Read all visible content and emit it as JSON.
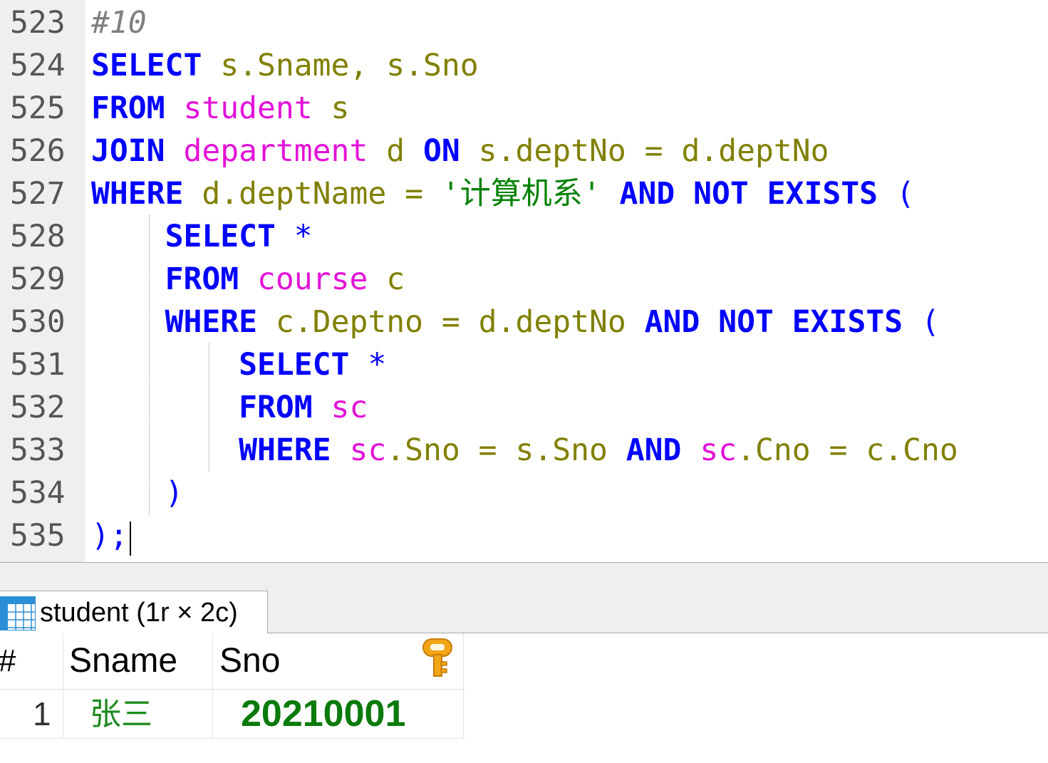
{
  "editor": {
    "lines": [
      {
        "num": "523",
        "tokens": [
          {
            "t": "#10",
            "k": "cm"
          }
        ]
      },
      {
        "num": "524",
        "tokens": [
          {
            "t": "SELECT",
            "k": "kw"
          },
          {
            "t": " s.Sname, s.Sno",
            "k": "id"
          }
        ]
      },
      {
        "num": "525",
        "tokens": [
          {
            "t": "FROM",
            "k": "kw"
          },
          {
            "t": " student",
            "k": "tb"
          },
          {
            "t": " s",
            "k": "id"
          }
        ]
      },
      {
        "num": "526",
        "tokens": [
          {
            "t": "JOIN",
            "k": "kw"
          },
          {
            "t": " department",
            "k": "tb"
          },
          {
            "t": " d ",
            "k": "id"
          },
          {
            "t": "ON",
            "k": "kw"
          },
          {
            "t": " s.deptNo = d.deptNo",
            "k": "id"
          }
        ]
      },
      {
        "num": "527",
        "tokens": [
          {
            "t": "WHERE",
            "k": "kw"
          },
          {
            "t": " d.deptName = ",
            "k": "id"
          },
          {
            "t": "'计算机系'",
            "k": "st"
          },
          {
            "t": " AND NOT EXISTS ",
            "k": "kw"
          },
          {
            "t": "(",
            "k": "pn"
          }
        ]
      },
      {
        "num": "528",
        "tokens": [
          {
            "t": "    ",
            "k": "id"
          },
          {
            "t": "SELECT",
            "k": "kw"
          },
          {
            "t": " *",
            "k": "pn"
          }
        ]
      },
      {
        "num": "529",
        "tokens": [
          {
            "t": "    ",
            "k": "id"
          },
          {
            "t": "FROM",
            "k": "kw"
          },
          {
            "t": " course",
            "k": "tb"
          },
          {
            "t": " c",
            "k": "id"
          }
        ]
      },
      {
        "num": "530",
        "tokens": [
          {
            "t": "    ",
            "k": "id"
          },
          {
            "t": "WHERE",
            "k": "kw"
          },
          {
            "t": " c.Deptno = d.deptNo ",
            "k": "id"
          },
          {
            "t": "AND NOT EXISTS ",
            "k": "kw"
          },
          {
            "t": "(",
            "k": "pn"
          }
        ]
      },
      {
        "num": "531",
        "tokens": [
          {
            "t": "        ",
            "k": "id"
          },
          {
            "t": "SELECT",
            "k": "kw"
          },
          {
            "t": " *",
            "k": "pn"
          }
        ]
      },
      {
        "num": "532",
        "tokens": [
          {
            "t": "        ",
            "k": "id"
          },
          {
            "t": "FROM",
            "k": "kw"
          },
          {
            "t": " sc",
            "k": "tb"
          }
        ]
      },
      {
        "num": "533",
        "tokens": [
          {
            "t": "        ",
            "k": "id"
          },
          {
            "t": "WHERE",
            "k": "kw"
          },
          {
            "t": " sc",
            "k": "tb"
          },
          {
            "t": ".Sno = s.Sno ",
            "k": "id"
          },
          {
            "t": "AND",
            "k": "kw"
          },
          {
            "t": " sc",
            "k": "tb"
          },
          {
            "t": ".Cno = c.Cno",
            "k": "id"
          }
        ]
      },
      {
        "num": "534",
        "tokens": [
          {
            "t": "    ",
            "k": "id"
          },
          {
            "t": ")",
            "k": "pn"
          }
        ]
      },
      {
        "num": "535",
        "tokens": [
          {
            "t": ");",
            "k": "pn"
          }
        ]
      }
    ]
  },
  "result_tab": {
    "label": "student (1r × 2c)"
  },
  "grid": {
    "columns": [
      "#",
      "Sname",
      "Sno"
    ],
    "key_icon": "key-icon",
    "rows": [
      {
        "index": "1",
        "sname": "张三",
        "sno": "20210001"
      }
    ]
  },
  "colors": {
    "keyword": "#0000ff",
    "identifier": "#808000",
    "table": "#e312d8",
    "string": "#008000",
    "value_green": "#0a7a0a"
  }
}
